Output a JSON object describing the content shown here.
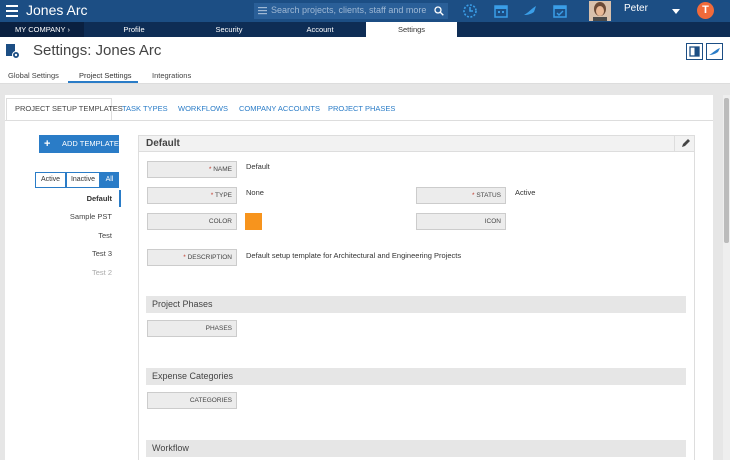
{
  "app": {
    "title": "Jones Arc"
  },
  "search": {
    "placeholder": "Search projects, clients, staff and more"
  },
  "user": {
    "name": "Peter",
    "brand_badge": "T"
  },
  "nav": {
    "company": "MY COMPANY  ›",
    "tabs": [
      "Profile",
      "Security",
      "Account",
      "Settings"
    ],
    "active_tab": "Settings"
  },
  "page": {
    "title": "Settings: Jones Arc"
  },
  "subtabs": [
    "Global Settings",
    "Project Settings",
    "Integrations"
  ],
  "template_tabs": [
    "PROJECT SETUP TEMPLATES",
    "TASK TYPES",
    "WORKFLOWS",
    "COMPANY ACCOUNTS",
    "PROJECT PHASES"
  ],
  "sidebar": {
    "add_button": "ADD TEMPLATE",
    "filters": [
      "Active",
      "Inactive",
      "All"
    ],
    "active_filter": "All",
    "templates": [
      {
        "label": "Default",
        "state": "selected"
      },
      {
        "label": "Sample PST",
        "state": "normal"
      },
      {
        "label": "Test",
        "state": "normal"
      },
      {
        "label": "Test 3",
        "state": "normal"
      },
      {
        "label": "Test 2",
        "state": "inactive"
      }
    ]
  },
  "panel": {
    "title": "Default",
    "fields": {
      "name_label": "NAME",
      "name_value": "Default",
      "type_label": "TYPE",
      "type_value": "None",
      "status_label": "STATUS",
      "status_value": "Active",
      "color_label": "COLOR",
      "color_value": "#f7941d",
      "icon_label": "ICON",
      "description_label": "DESCRIPTION",
      "description_value": "Default setup template for Architectural and Engineering Projects"
    },
    "sections": {
      "phases_title": "Project Phases",
      "phases_label": "PHASES",
      "expense_title": "Expense Categories",
      "categories_label": "CATEGORIES",
      "workflow_title": "Workflow"
    }
  },
  "colors": {
    "topbar": "#1c4e84",
    "navbar": "#0e2d55",
    "accent": "#2a7cc7",
    "badge": "#f16a3a"
  }
}
